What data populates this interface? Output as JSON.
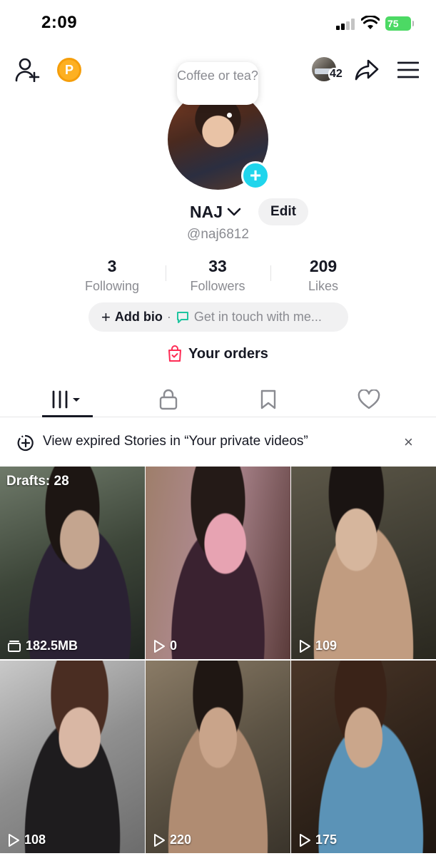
{
  "status_bar": {
    "time": "2:09",
    "battery": "75"
  },
  "header": {
    "viewer_count": "42"
  },
  "profile": {
    "bubble_text": "Coffee or tea?",
    "username": "NAJ",
    "edit_label": "Edit",
    "handle": "@naj6812"
  },
  "stats": [
    {
      "value": "3",
      "label": "Following"
    },
    {
      "value": "33",
      "label": "Followers"
    },
    {
      "value": "209",
      "label": "Likes"
    }
  ],
  "bio": {
    "add_label": "Add bio",
    "separator": "·",
    "touch_label": "Get in touch with me..."
  },
  "orders": {
    "label": "Your orders"
  },
  "tabs": [
    "videos-grid-icon",
    "lock-icon",
    "bookmark-icon",
    "heart-icon"
  ],
  "banner": {
    "text": "View expired Stories in “Your private videos”",
    "close": "×"
  },
  "grid": {
    "drafts_label": "Drafts: 28",
    "items": [
      {
        "label": "182.5MB",
        "icon": "drafts-icon"
      },
      {
        "label": "0",
        "icon": "play-icon"
      },
      {
        "label": "109",
        "icon": "play-icon"
      },
      {
        "label": "108",
        "icon": "play-icon"
      },
      {
        "label": "220",
        "icon": "play-icon"
      },
      {
        "label": "175",
        "icon": "play-icon"
      }
    ]
  },
  "colors": {
    "accent_cyan": "#20d5ec",
    "coin": "#fdb022",
    "battery": "#4cd964"
  }
}
